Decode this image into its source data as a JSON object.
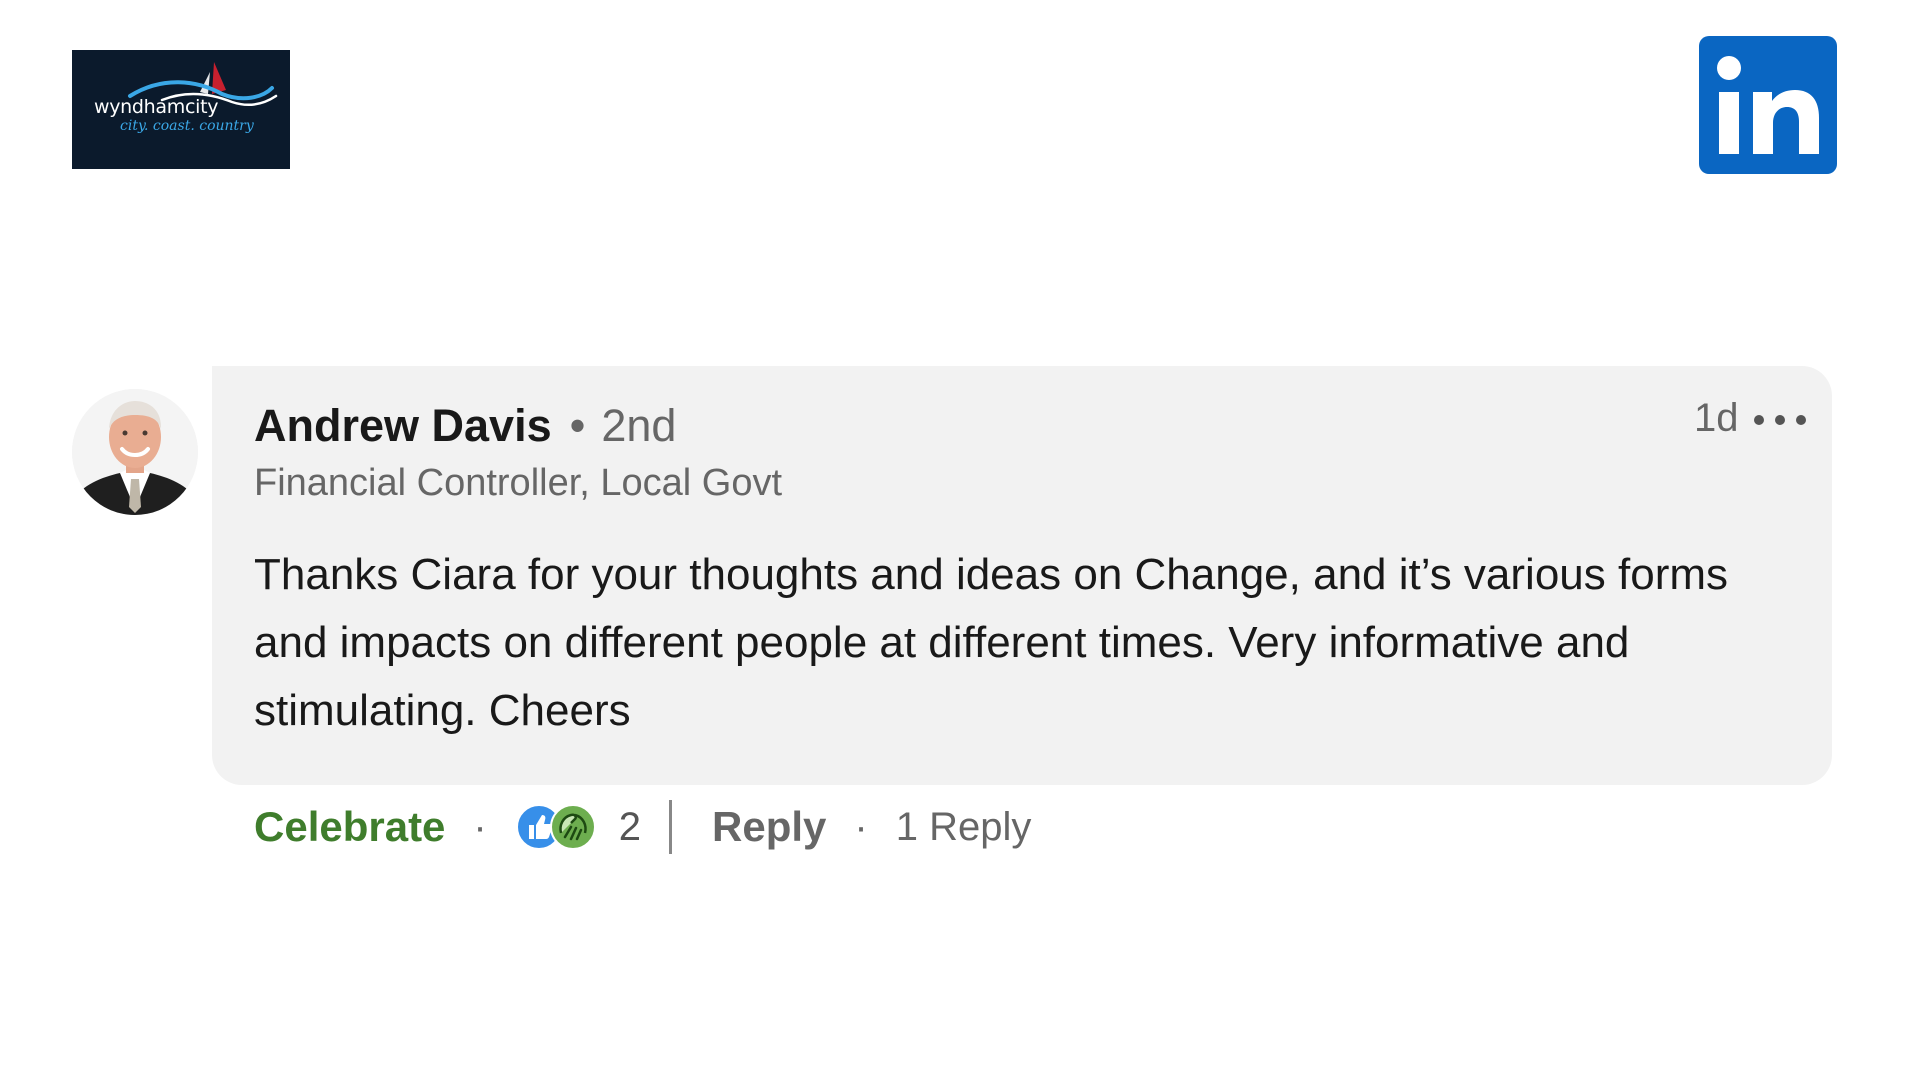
{
  "organization_logo": {
    "name": "wyndhamcity",
    "tagline": "city. coast. country"
  },
  "linkedin_logo": {
    "text": "in",
    "color": "#0a66c2"
  },
  "comment": {
    "author": {
      "name": "Andrew Davis",
      "separator": "•",
      "connection_degree": "2nd",
      "headline": "Financial Controller, Local Govt"
    },
    "timestamp": "1d",
    "more_icon": "ellipsis-icon",
    "text": "Thanks Ciara for your thoughts and ideas on Change, and it’s various forms and impacts on different people at different times. Very informative and stimulating. Cheers",
    "bubble_color": "#f2f2f2"
  },
  "actions": {
    "reaction_label": "Celebrate",
    "reaction_color": "#3f7d2c",
    "separator": "·",
    "reaction_icons": [
      "like-icon",
      "celebrate-icon"
    ],
    "reaction_count": "2",
    "reply_label": "Reply",
    "replies_count_label": "1 Reply"
  }
}
